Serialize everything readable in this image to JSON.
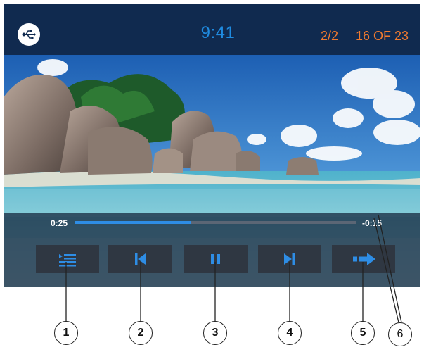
{
  "statusbar": {
    "source_icon": "usb-icon",
    "clock": "9:41",
    "folder_count": "2/2",
    "track_count": "16 OF 23",
    "accent_color": "#f07a2f",
    "clock_color": "#1f8be0"
  },
  "video": {
    "scene": "beach-granite-rocks-icon"
  },
  "playback": {
    "elapsed": "0:25",
    "remaining": "-0:15",
    "progress": 0.41
  },
  "buttons": [
    {
      "icon": "playlist-icon",
      "callout": "1"
    },
    {
      "icon": "skip-previous-icon",
      "callout": "2"
    },
    {
      "icon": "pause-icon",
      "callout": "3"
    },
    {
      "icon": "skip-next-icon",
      "callout": "4"
    },
    {
      "icon": "repeat-arrow-icon",
      "callout": "5"
    }
  ],
  "callouts": [
    "1",
    "2",
    "3",
    "4",
    "5",
    "6"
  ]
}
